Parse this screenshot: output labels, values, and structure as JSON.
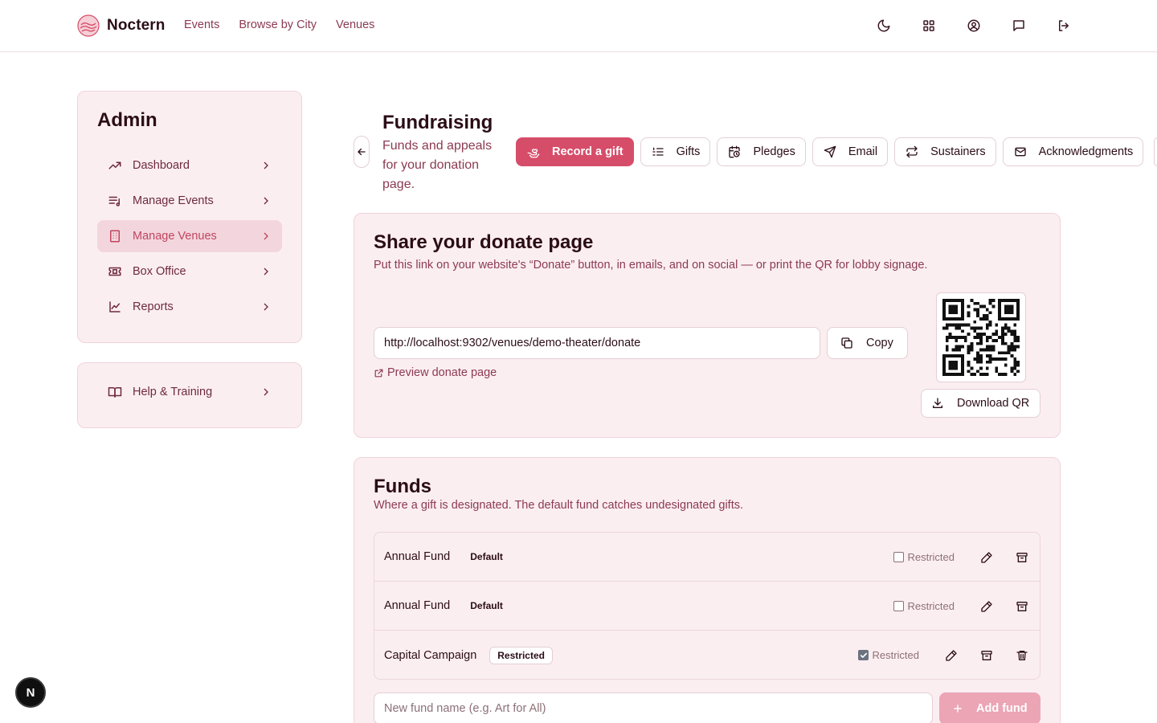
{
  "brand": {
    "name": "Noctern",
    "logo_icon": "noctern-logo-icon"
  },
  "nav": {
    "links": [
      "Events",
      "Browse by City",
      "Venues"
    ],
    "icons": [
      "moon-icon",
      "grid-icon",
      "user-circle-icon",
      "message-icon",
      "logout-icon"
    ]
  },
  "sidebar": {
    "title": "Admin",
    "items": [
      {
        "label": "Dashboard",
        "icon": "trending-up-icon",
        "active": false
      },
      {
        "label": "Manage Events",
        "icon": "list-music-icon",
        "active": false
      },
      {
        "label": "Manage Venues",
        "icon": "building-icon",
        "active": true
      },
      {
        "label": "Box Office",
        "icon": "ticket-icon",
        "active": false
      },
      {
        "label": "Reports",
        "icon": "line-chart-icon",
        "active": false
      }
    ],
    "help": {
      "label": "Help & Training",
      "icon": "book-open-icon"
    }
  },
  "header": {
    "title": "Fundraising",
    "subtitle": "Funds and appeals for your donation page."
  },
  "tabs": [
    {
      "label": "Record a gift",
      "icon": "hand-heart-icon",
      "primary": true
    },
    {
      "label": "Gifts",
      "icon": "list-ordered-icon",
      "primary": false
    },
    {
      "label": "Pledges",
      "icon": "calendar-clock-icon",
      "primary": false
    },
    {
      "label": "Email",
      "icon": "send-icon",
      "primary": false
    },
    {
      "label": "Sustainers",
      "icon": "repeat-icon",
      "primary": false
    },
    {
      "label": "Acknowledgments",
      "icon": "mail-icon",
      "primary": false
    }
  ],
  "share": {
    "title": "Share your donate page",
    "description": "Put this link on your website's “Donate” button, in emails, and on social — or print the QR for lobby signage.",
    "url": "http://localhost:9302/venues/demo-theater/donate",
    "copy_label": "Copy",
    "preview_label": "Preview donate page",
    "download_label": "Download QR"
  },
  "funds": {
    "title": "Funds",
    "description": "Where a gift is designated. The default fund catches undesignated gifts.",
    "rows": [
      {
        "name": "Annual Fund",
        "badge": "Default",
        "restricted_label": "Restricted",
        "restricted": false,
        "deletable": false
      },
      {
        "name": "Annual Fund",
        "badge": "Default",
        "restricted_label": "Restricted",
        "restricted": false,
        "deletable": false
      },
      {
        "name": "Capital Campaign",
        "badge": "Restricted",
        "restricted_label": "Restricted",
        "restricted": true,
        "deletable": true
      }
    ],
    "new_fund_placeholder": "New fund name (e.g. Art for All)",
    "add_label": "Add fund"
  },
  "dev_badge": "N",
  "colors": {
    "accent": "#d64d6a",
    "panel_bg": "#fbeef1",
    "link": "#8c3a52",
    "active_bg": "#f3d6dd"
  }
}
